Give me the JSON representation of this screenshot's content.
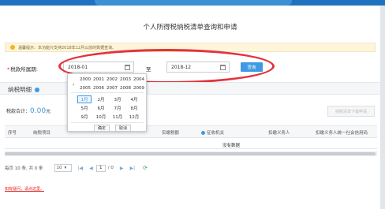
{
  "page": {
    "title": "个人所得税纳税清单查询和申请",
    "notice": "温馨提示：本功能只支持2018年12月以前的数据查询。"
  },
  "colors": {
    "accent": "#3f9ae3",
    "highlight_ellipse": "#e3333c",
    "notice_bg": "#fdf6dc",
    "link_red": "#e02020"
  },
  "query": {
    "required_mark": "*",
    "period_label": "税款所属期:",
    "start_value": "2018-01",
    "to_label": "至",
    "end_value": "2018-12",
    "query_button": "查询"
  },
  "section": {
    "title": "纳税明细",
    "total_label": "税款合计：",
    "total_amount": "0.00",
    "total_unit": "元",
    "apply_button": "纳税清单下载申请"
  },
  "table": {
    "columns": [
      "序号",
      "纳税项目",
      "实缴税额",
      "征收机关",
      "扣缴义务人",
      "扣缴义务人统一社会信用码"
    ],
    "empty_text": "没有数据"
  },
  "pager": {
    "summary": "每页 10 条, 共 0 条",
    "page_size": "10",
    "first": "|◀",
    "prev": "◀",
    "current_page": "1",
    "total_pages": "/ 0",
    "next": "▶",
    "last": "▶|",
    "refresh_icon": "refresh-icon"
  },
  "footer": {
    "link": "如有疑问，请点这里。"
  },
  "picker": {
    "prev_arrow": "‹",
    "years_row1": [
      "2000",
      "2001",
      "2002",
      "2003",
      "2004"
    ],
    "years_row2": [
      "2005",
      "2006",
      "2007",
      "2008",
      "2009"
    ],
    "months": [
      "1月",
      "2月",
      "3月",
      "4月",
      "5月",
      "6月",
      "7月",
      "8月",
      "9月",
      "10月",
      "11月",
      "12月"
    ],
    "selected_month": "1月",
    "confirm": "确定",
    "cancel": "取消"
  }
}
